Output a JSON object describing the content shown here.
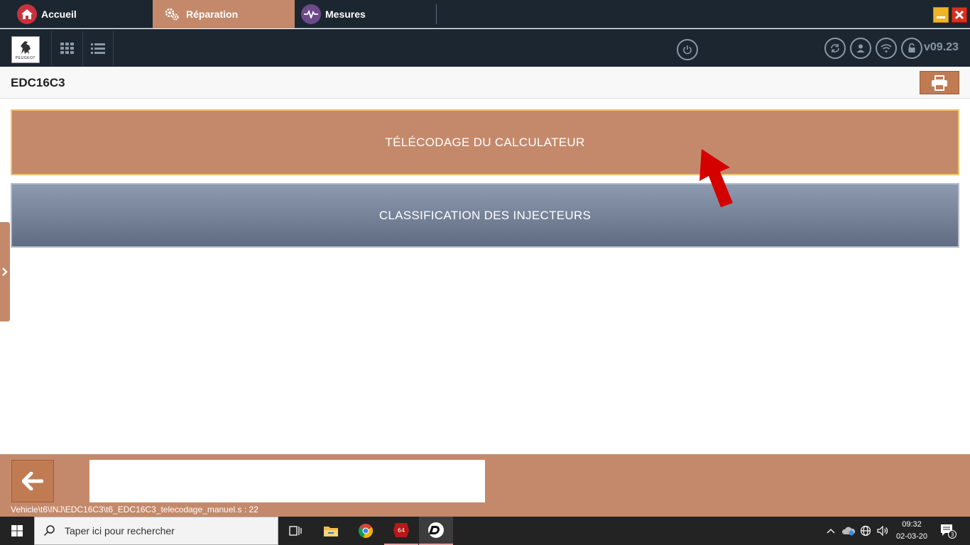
{
  "tabs": [
    {
      "label": "Accueil"
    },
    {
      "label": "Réparation"
    },
    {
      "label": "Mesures"
    }
  ],
  "toolbar": {
    "brand": "PEUGEOT",
    "version": "v09.23"
  },
  "page": {
    "title": "EDC16C3"
  },
  "menu": {
    "items": [
      {
        "label": "TÉLÉCODAGE DU CALCULATEUR"
      },
      {
        "label": "CLASSIFICATION DES INJECTEURS"
      }
    ]
  },
  "footer": {
    "path": "Vehicle\\t6\\INJ\\EDC16C3\\t6_EDC16C3_telecodage_manuel.s : 22"
  },
  "taskbar": {
    "search_placeholder": "Taper ici pour rechercher",
    "time": "09:32",
    "date": "02-03-20",
    "notifications": "3",
    "app_badge": "64"
  },
  "colors": {
    "accent": "#c4896a",
    "dark": "#1c2630",
    "highlight_border": "#f5c272",
    "arrow": "#d40000"
  }
}
